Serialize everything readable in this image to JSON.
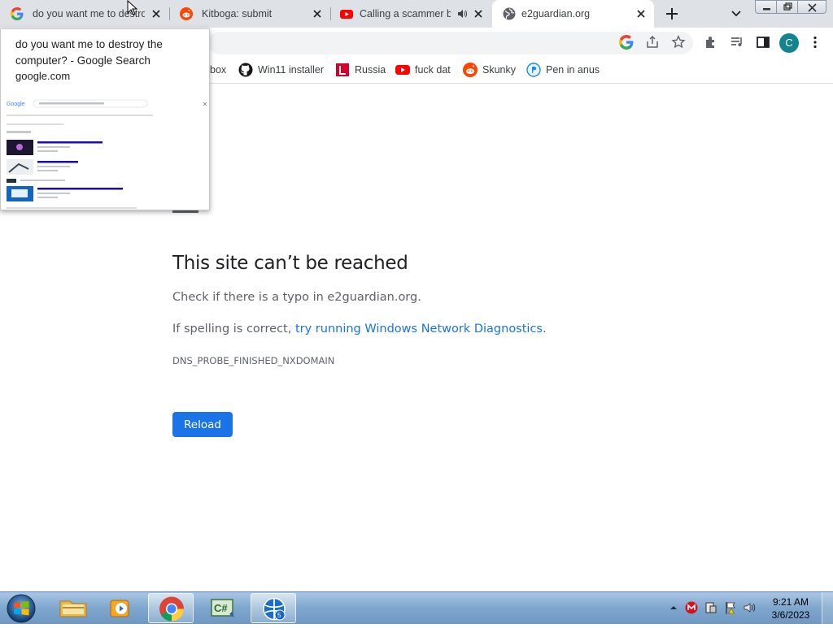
{
  "tabs": [
    {
      "title": "do you want me to destro",
      "icon": "google-icon"
    },
    {
      "title": "Kitboga: submit",
      "icon": "reddit-icon"
    },
    {
      "title": "Calling a scammer by",
      "icon": "youtube-icon"
    },
    {
      "title": "e2guardian.org",
      "icon": "globe-icon"
    }
  ],
  "bookmarks": [
    {
      "label": "box",
      "icon": "partial-icon"
    },
    {
      "label": "Win11 installer",
      "icon": "github-icon"
    },
    {
      "label": "Russia",
      "icon": "russia-icon"
    },
    {
      "label": "fuck dat",
      "icon": "youtube-icon"
    },
    {
      "label": "Skunky",
      "icon": "reddit-icon"
    },
    {
      "label": "Pen in anus",
      "icon": "pen-icon"
    }
  ],
  "profile": {
    "initial": "C",
    "color": "#12848f"
  },
  "error": {
    "heading": "This site can’t be reached",
    "line1_prefix": "Check if there is a typo in ",
    "line1_domain": "e2guardian.org",
    "line1_suffix": ".",
    "line2_prefix": "If spelling is correct, ",
    "line2_link": "try running Windows Network Diagnostics",
    "line2_suffix": ".",
    "code": "DNS_PROBE_FINISHED_NXDOMAIN",
    "reload_label": "Reload"
  },
  "hovercard": {
    "title": "do you want me to destroy the computer? - Google Search",
    "domain": "google.com"
  },
  "taskbar": {
    "apps": [
      "explorer-icon",
      "media-player-icon",
      "chrome-icon",
      "csharp-icon",
      "network-app-icon"
    ],
    "time": "9:21 AM",
    "date": "3/6/2023"
  },
  "colors": {
    "accent": "#1a73e8",
    "tabstrip": "#dee1e6",
    "taskbar": "#7fa6cd"
  }
}
